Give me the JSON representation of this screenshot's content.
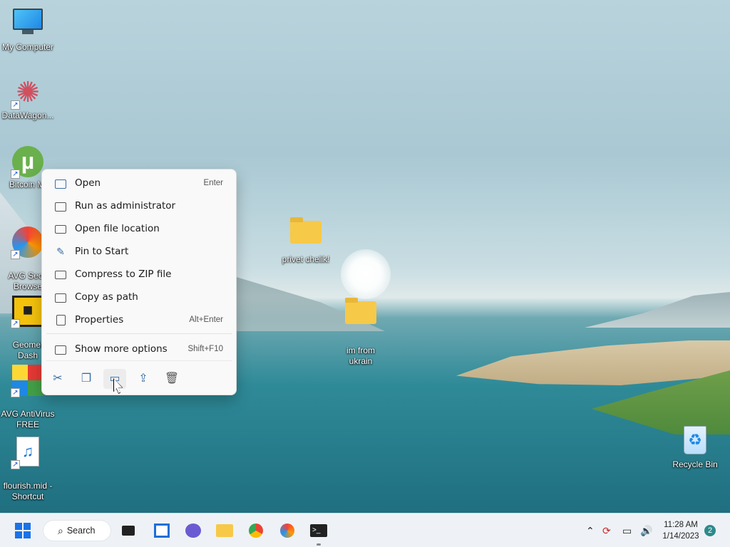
{
  "desktop_icons": [
    {
      "id": "my-computer",
      "label": "My Computer",
      "icon": "monitor-icon"
    },
    {
      "id": "datawagon",
      "label": "DataWagon...",
      "icon": "star-icon"
    },
    {
      "id": "bitcoin",
      "label": "Bitcoin Mi",
      "icon": "utorrent-icon"
    },
    {
      "id": "avg-secure",
      "label": "AVG Secu\nBrowse",
      "icon": "avg-secure-browser-icon"
    },
    {
      "id": "geometry-dash",
      "label": "Geomet\nDash",
      "icon": "geometry-dash-icon"
    },
    {
      "id": "avg-antivirus",
      "label": "AVG AntiVirus\nFREE",
      "icon": "avg-antivirus-icon"
    },
    {
      "id": "flourish",
      "label": "flourish.mid -\nShortcut",
      "icon": "audio-file-icon"
    },
    {
      "id": "privet",
      "label": "privet chelik!",
      "icon": "folder-icon"
    },
    {
      "id": "im-from",
      "label": "im from\nukrain",
      "icon": "folder-icon"
    },
    {
      "id": "recycle",
      "label": "Recycle Bin",
      "icon": "recycle-bin-icon"
    }
  ],
  "context_menu": {
    "items": [
      {
        "label": "Open",
        "shortcut": "Enter",
        "icon": "open-window-icon"
      },
      {
        "label": "Run as administrator",
        "shortcut": "",
        "icon": "shield-admin-icon"
      },
      {
        "label": "Open file location",
        "shortcut": "",
        "icon": "folder-icon"
      },
      {
        "label": "Pin to Start",
        "shortcut": "",
        "icon": "pin-icon"
      },
      {
        "label": "Compress to ZIP file",
        "shortcut": "",
        "icon": "zip-folder-icon"
      },
      {
        "label": "Copy as path",
        "shortcut": "",
        "icon": "copy-path-icon"
      },
      {
        "label": "Properties",
        "shortcut": "Alt+Enter",
        "icon": "properties-icon"
      }
    ],
    "more": {
      "label": "Show more options",
      "shortcut": "Shift+F10",
      "icon": "more-options-icon"
    },
    "toolbar": [
      "cut-icon",
      "copy-icon",
      "rename-icon",
      "share-icon",
      "delete-icon"
    ]
  },
  "taskbar": {
    "search_label": "Search",
    "apps": [
      "task-view-icon",
      "widgets-icon",
      "chat-icon",
      "file-explorer-icon",
      "chrome-icon",
      "avg-browser-icon",
      "terminal-icon"
    ],
    "time": "11:28 AM",
    "date": "1/14/2023",
    "notifications": "2"
  },
  "colors": {
    "accent": "#1a73e8",
    "menu_bg": "#f9f9f9",
    "taskbar_bg": "#eef2f6"
  }
}
